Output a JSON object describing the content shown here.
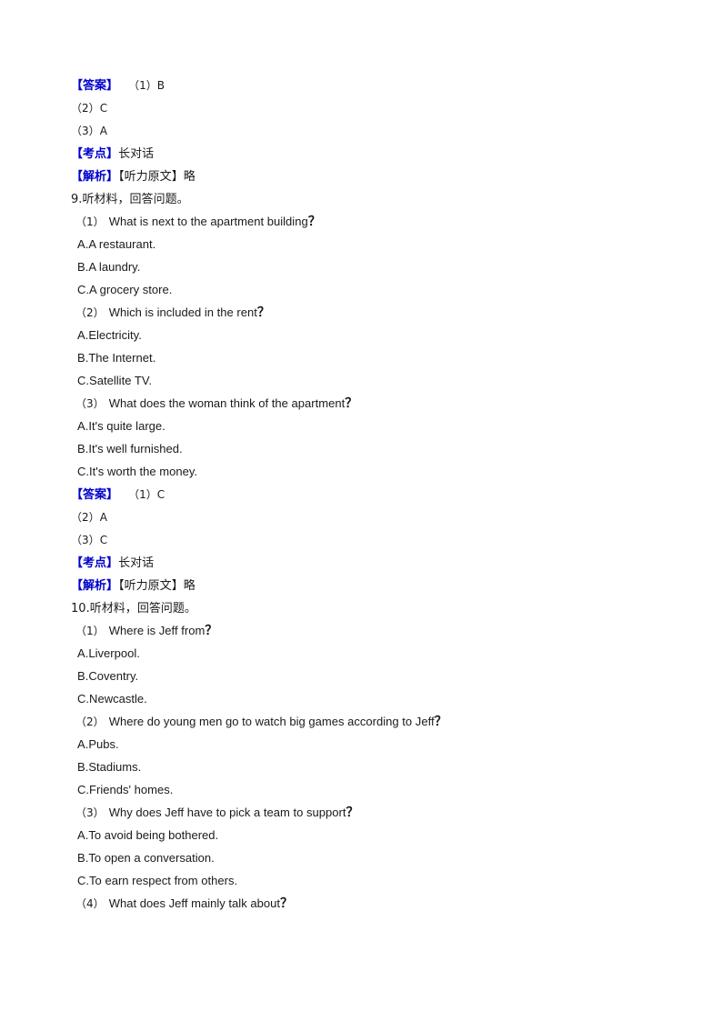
{
  "page": {
    "background": "#ffffff",
    "text_color": "#1a1a1a",
    "accent_color": "#0000cc"
  },
  "labels": {
    "answer": "【答案】",
    "knowledge_point": "【考点】",
    "analysis": "【解析】",
    "listening_script": "【听力原文】",
    "omitted": "略",
    "long_dialogue": "长对话"
  },
  "blocks": [
    {
      "id": "answer-block-8",
      "type": "answer",
      "tag": "【答案】",
      "first_answer": "（1）B",
      "more_answers": [
        "（2）C",
        "（3）A"
      ],
      "knowledge_tag": "【考点】",
      "knowledge_value": "长对话",
      "analysis_tag": "【解析】",
      "analysis_inner": "【听力原文】",
      "analysis_value": "略"
    },
    {
      "id": "question-9",
      "type": "question",
      "number": "9.",
      "prompt": "听材料，回答问题。",
      "items": [
        {
          "label": "（1）",
          "stem": "What is next to the apartment building",
          "qmark": "？",
          "options": [
            "A.A restaurant.",
            "B.A laundry.",
            "C.A grocery store."
          ]
        },
        {
          "label": "（2）",
          "stem": "Which is included in the rent",
          "qmark": "？",
          "options": [
            "A.Electricity.",
            "B.The Internet.",
            "C.Satellite TV."
          ]
        },
        {
          "label": "（3）",
          "stem": "What does the woman think of the apartment",
          "qmark": "？",
          "options": [
            "A.It's quite large.",
            "B.It's well furnished.",
            "C.It's worth the money."
          ]
        }
      ]
    },
    {
      "id": "answer-block-9",
      "type": "answer",
      "tag": "【答案】",
      "first_answer": "（1）C",
      "more_answers": [
        "（2）A",
        "（3）C"
      ],
      "knowledge_tag": "【考点】",
      "knowledge_value": "长对话",
      "analysis_tag": "【解析】",
      "analysis_inner": "【听力原文】",
      "analysis_value": "略"
    },
    {
      "id": "question-10",
      "type": "question",
      "number": "10.",
      "prompt": "听材料，回答问题。",
      "items": [
        {
          "label": "（1）",
          "stem": "Where is Jeff from",
          "qmark": "？",
          "options": [
            "A.Liverpool.",
            "B.Coventry.",
            "C.Newcastle."
          ]
        },
        {
          "label": "（2）",
          "stem": "Where do young men go to watch big games according to Jeff",
          "qmark": "？",
          "options": [
            "A.Pubs.",
            "B.Stadiums.",
            "C.Friends' homes."
          ]
        },
        {
          "label": "（3）",
          "stem": "Why does Jeff have to pick a team to support",
          "qmark": "？",
          "options": [
            "A.To avoid being bothered.",
            "B.To open a conversation.",
            "C.To earn respect from others."
          ]
        },
        {
          "label": "（4）",
          "stem": "What does Jeff mainly talk about",
          "qmark": "？",
          "options": []
        }
      ]
    }
  ]
}
